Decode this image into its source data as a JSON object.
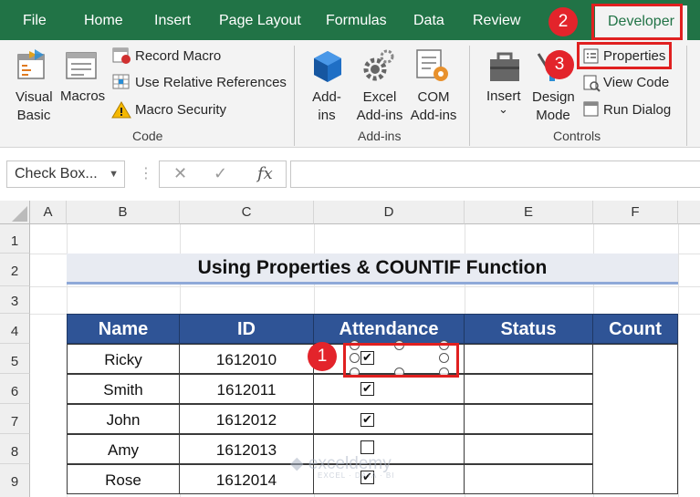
{
  "tabs": [
    "File",
    "Home",
    "Insert",
    "Page Layout",
    "Formulas",
    "Data",
    "Review",
    "Developer"
  ],
  "ribbon": {
    "code": {
      "visual_basic": [
        "Visual",
        "Basic"
      ],
      "macros": "Macros",
      "record_macro": "Record Macro",
      "use_relative": "Use Relative References",
      "macro_security": "Macro Security",
      "title": "Code"
    },
    "addins": {
      "addins": [
        "Add-",
        "ins"
      ],
      "excel_addins": [
        "Excel",
        "Add-ins"
      ],
      "com_addins": [
        "COM",
        "Add-ins"
      ],
      "title": "Add-ins"
    },
    "controls": {
      "insert": "Insert",
      "insert_arrow": "⌄",
      "design_mode": [
        "Design",
        "Mode"
      ],
      "properties": "Properties",
      "view_code": "View Code",
      "run_dialog": "Run Dialog",
      "title": "Controls"
    }
  },
  "formula_bar": {
    "name_box": "Check Box...",
    "cancel": "✕",
    "enter": "✓",
    "fx": "fx",
    "value": ""
  },
  "columns": [
    "A",
    "B",
    "C",
    "D",
    "E",
    "F"
  ],
  "rows": [
    "1",
    "2",
    "3",
    "4",
    "5",
    "6",
    "7",
    "8",
    "9"
  ],
  "sheet": {
    "title": "Using Properties & COUNTIF Function",
    "headers": [
      "Name",
      "ID",
      "Attendance",
      "Status",
      "Count"
    ],
    "records": [
      {
        "name": "Ricky",
        "id": "1612010",
        "checked": true
      },
      {
        "name": "Smith",
        "id": "1612011",
        "checked": true
      },
      {
        "name": "John",
        "id": "1612012",
        "checked": true
      },
      {
        "name": "Amy",
        "id": "1612013",
        "checked": false
      },
      {
        "name": "Rose",
        "id": "1612014",
        "checked": true
      }
    ]
  },
  "callouts": [
    "1",
    "2",
    "3"
  ],
  "watermark": {
    "brand": "exceldemy",
    "tagline": "EXCEL · DATA · BI"
  },
  "colors": {
    "ribbon_green": "#217346",
    "header_blue": "#2f5496",
    "callout_red": "#e3242b"
  }
}
